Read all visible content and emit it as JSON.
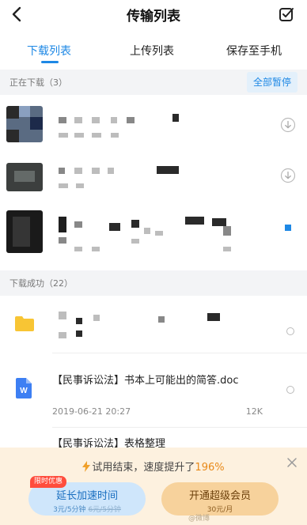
{
  "header": {
    "title": "传输列表"
  },
  "tabs": [
    {
      "label": "下载列表",
      "active": true
    },
    {
      "label": "上传列表",
      "active": false
    },
    {
      "label": "保存至手机",
      "active": false
    }
  ],
  "downloading": {
    "label": "正在下载（3）",
    "pause_all": "全部暂停"
  },
  "downloaded": {
    "label": "下载成功（22）",
    "items": [
      {
        "date": "2019-06-21 17:23",
        "icon": "folder-icon"
      },
      {
        "name": "【民事诉讼法】书本上可能出的简答.doc",
        "date": "2019-06-21 20:27",
        "size": "12K",
        "icon": "word-doc-icon"
      },
      {
        "name": "【民事诉讼法】表格整理",
        "icon": "word-doc-icon"
      }
    ]
  },
  "promo": {
    "text_prefix": "试用结束，速度提升了",
    "text_value": "196%",
    "badge": "限时优惠",
    "extend_label": "延长加速时间",
    "extend_price_new": "3元/5分钟",
    "extend_price_old": "6元/5分钟",
    "vip_label": "开通超级会员",
    "vip_price": "30元/月",
    "watermark": "@微博"
  },
  "colors": {
    "accent": "#1e88e5",
    "promo_bg": "#fdf1df",
    "percent": "#e88a1a"
  }
}
